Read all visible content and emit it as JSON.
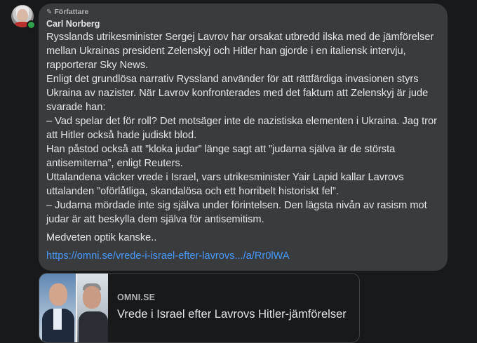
{
  "comment": {
    "badge_label": "Författare",
    "author": "Carl Norberg",
    "paragraphs": [
      "Rysslands utrikesminister Sergej Lavrov har orsakat utbredd ilska med de jämförelser mellan Ukrainas president Zelenskyj och Hitler han gjorde i en italiensk intervju, rapporterar Sky News.",
      "Enligt det grundlösa narrativ Ryssland använder för att rättfärdiga invasionen styrs Ukraina av nazister. När Lavrov konfronterades med det faktum att Zelenskyj är jude svarade han:",
      "– Vad spelar det för roll? Det motsäger inte de nazistiska elementen i Ukraina. Jag tror att Hitler också hade judiskt blod.",
      "Han påstod också att ”kloka judar” länge sagt att ”judarna själva är de största antisemiterna”, enligt Reuters.",
      "Uttalandena väcker vrede i Israel, vars utrikesminister Yair Lapid kallar Lavrovs uttalanden ”oförlåtliga, skandalösa och ett horribelt historiskt fel”.",
      "– Judarna mördade inte sig själva under förintelsen. Den lägsta nivån av rasism mot judar är att beskylla dem själva för antisemitism.",
      "Medveten optik kanske.."
    ],
    "link_text": "https://omni.se/vrede-i-israel-efter-lavrovs.../a/Rr0lWA"
  },
  "link_preview": {
    "domain": "OMNI.SE",
    "title": "Vrede i Israel efter Lavrovs Hitler-jämförelser"
  },
  "colors": {
    "background": "#18191a",
    "bubble": "#3a3b3c",
    "text": "#e4e6eb",
    "secondary_text": "#b0b3b8",
    "link": "#4599ff",
    "online": "#31a24c"
  }
}
